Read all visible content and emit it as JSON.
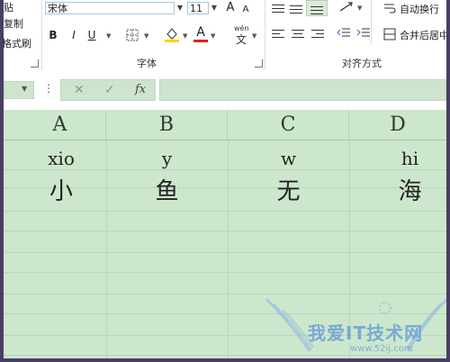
{
  "ribbon": {
    "clipboard": {
      "item1": "贴",
      "item2": "复制",
      "item3": "格式刷"
    },
    "font": {
      "name": "宋体",
      "size": "11",
      "increase": "A",
      "decrease": "A",
      "bold": "B",
      "italic": "I",
      "underline": "U",
      "wen": "wén",
      "wen2": "文",
      "group_label": "字体"
    },
    "alignment": {
      "wrap_text": "自动换行",
      "merge_center": "合并后居中",
      "group_label": "对齐方式"
    }
  },
  "formula_bar": {
    "fx": "fx",
    "cancel": "✕",
    "confirm": "✓",
    "value": ""
  },
  "grid": {
    "columns": [
      "A",
      "B",
      "C",
      "D"
    ],
    "row1": [
      "xio",
      "y",
      "w",
      "hi"
    ],
    "row2": [
      "小",
      "鱼",
      "无",
      "海"
    ]
  },
  "watermark": {
    "text": "我爱IT技术网",
    "sub": "www.52ij.com"
  },
  "colors": {
    "fill": "#ffd400",
    "font_color": "#e02020",
    "grid_bg": "#cde7cd"
  }
}
